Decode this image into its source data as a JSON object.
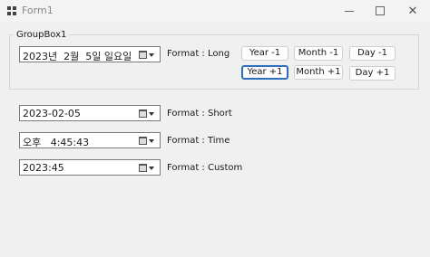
{
  "window": {
    "title": "Form1"
  },
  "group": {
    "label": "GroupBox1"
  },
  "pickers": [
    {
      "value": "2023년  2월  5일 일요일",
      "format_label": "Format : Long"
    },
    {
      "value": "2023-02-05",
      "format_label": "Format : Short"
    },
    {
      "value": "오후   4:45:43",
      "format_label": "Format : Time"
    },
    {
      "value": "2023:45",
      "format_label": "Format : Custom"
    }
  ],
  "buttons": {
    "year_minus": "Year -1",
    "month_minus": "Month -1",
    "day_minus": "Day -1",
    "year_plus": "Year +1",
    "month_plus": "Month +1",
    "day_plus": "Day +1"
  },
  "icons": {
    "app": "form-icon",
    "picker_dropdown": "calendar-dropdown-icon"
  }
}
